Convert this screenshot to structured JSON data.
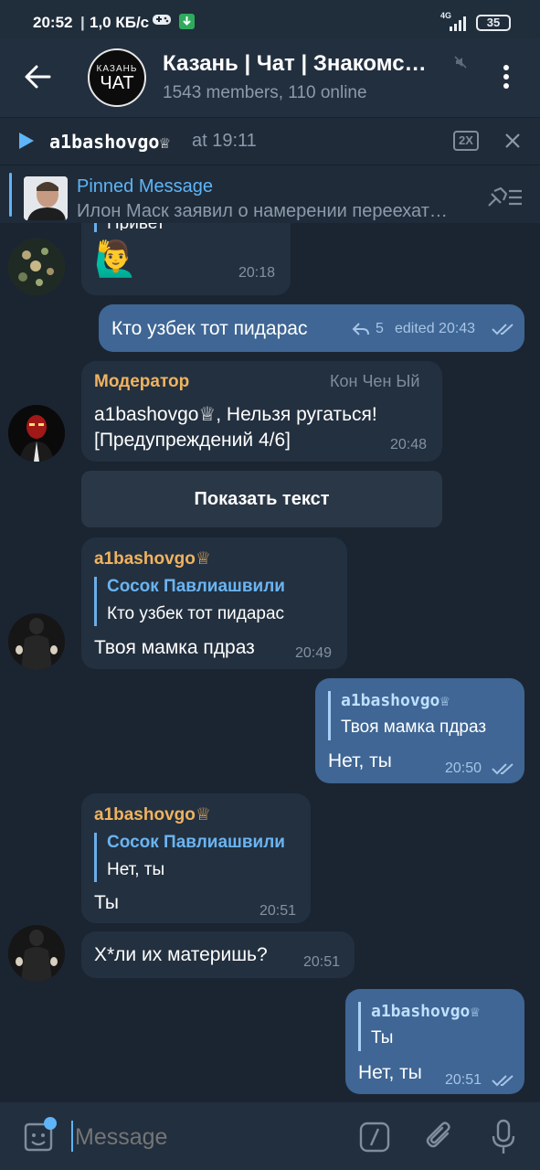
{
  "status_bar": {
    "time": "20:52",
    "speed": "1,0 КБ/с",
    "network": "4G",
    "battery": "35"
  },
  "header": {
    "avatar_line1": "КАЗАНЬ",
    "avatar_line2": "ЧАТ",
    "title": "Казань | Чат | Знакомс…",
    "subtitle": "1543 members, 110 online"
  },
  "player": {
    "author": "a1bashovgo♕",
    "time": "at 19:11",
    "speed": "2X"
  },
  "pinned": {
    "label": "Pinned Message",
    "text": "Илон Маск заявил о намерении переехат…"
  },
  "messages": {
    "m1": {
      "partial": "Привет",
      "emoji": "🙋‍♂️",
      "time": "20:18"
    },
    "m2": {
      "text": "Кто узбек тот пидарас",
      "replies": "5",
      "time": "edited 20:43"
    },
    "m3": {
      "sender": "Модератор",
      "tag": "Кон Чен Ый",
      "line1": "a1bashovgo♕, Нельзя ругаться!",
      "line2": "[Предупреждений 4/6]",
      "time": "20:48"
    },
    "button": {
      "label": "Показать текст"
    },
    "m4": {
      "sender": "a1bashovgo♕",
      "reply_name": "Сосок Павлиашвили",
      "reply_text": "Кто узбек тот пидарас",
      "text": "Твоя мамка пдраз",
      "time": "20:49"
    },
    "m5": {
      "reply_name": "a1bashovgo♕",
      "reply_text": "Твоя мамка пдраз",
      "text": "Нет, ты",
      "time": "20:50"
    },
    "m6": {
      "sender": "a1bashovgo♕",
      "reply_name": "Сосок Павлиашвили",
      "reply_text": "Нет, ты",
      "text": "Ты",
      "time": "20:51"
    },
    "m7": {
      "text": "Х*ли их материшь?",
      "time": "20:51"
    },
    "m8": {
      "reply_name": "a1bashovgo♕",
      "reply_text": "Ты",
      "text": "Нет, ты",
      "time": "20:51"
    }
  },
  "input": {
    "placeholder": "Message"
  },
  "colors": {
    "accent": "#6ab4f2",
    "outgoing": "#3f6694",
    "incoming": "#23303f",
    "sender": "#f0b35f"
  }
}
